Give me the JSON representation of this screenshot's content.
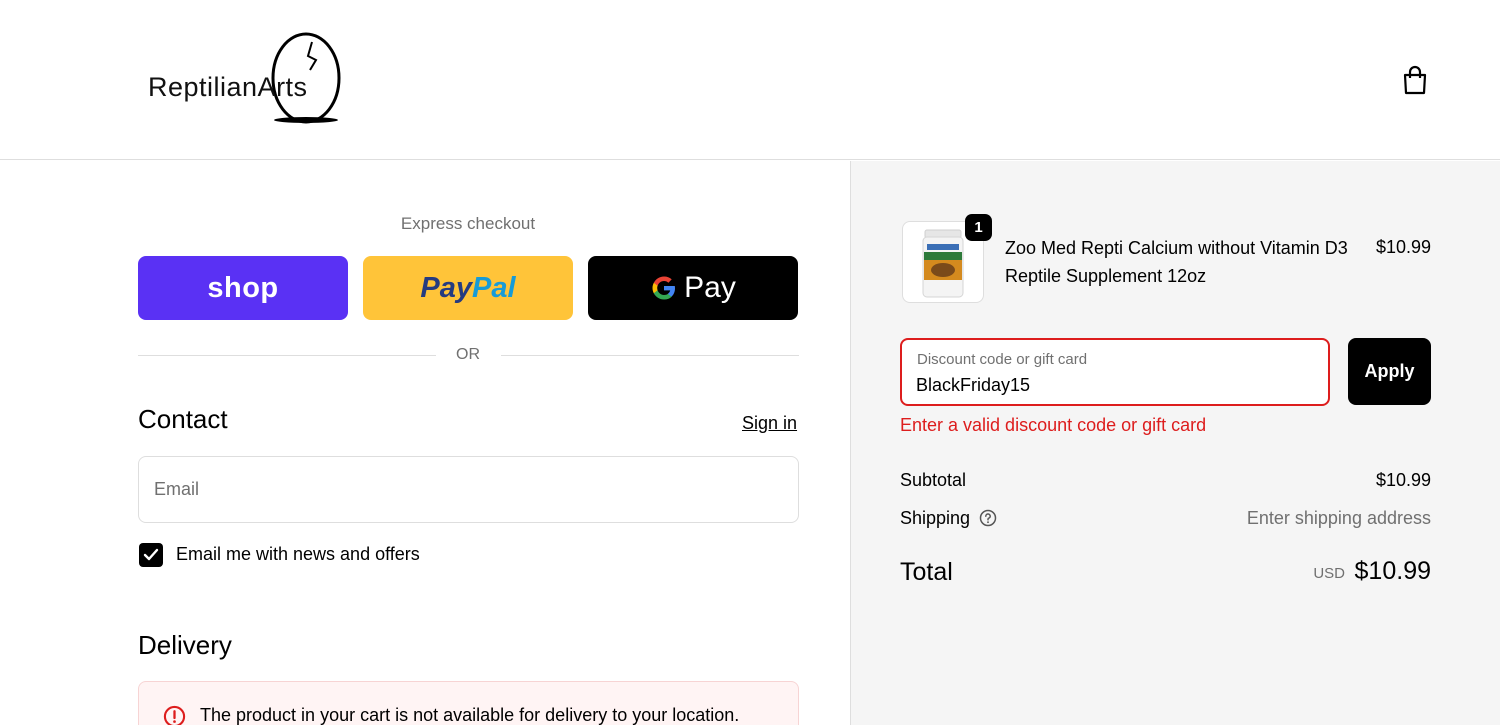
{
  "header": {
    "logo_text": "ReptilianArts"
  },
  "express": {
    "label": "Express checkout",
    "shop_label": "shop",
    "paypal_part1": "Pay",
    "paypal_part2": "Pal",
    "gpay_label": "Pay",
    "or_label": "OR"
  },
  "contact": {
    "heading": "Contact",
    "signin_label": "Sign in",
    "email_placeholder": "Email",
    "newsletter_label": "Email me with news and offers",
    "newsletter_checked": true
  },
  "delivery": {
    "heading": "Delivery",
    "alert_text": "The product in your cart is not available for delivery to your location."
  },
  "summary": {
    "product": {
      "name": "Zoo Med Repti Calcium without Vitamin D3 Reptile Supplement 12oz",
      "price": "$10.99",
      "quantity": "1"
    },
    "discount": {
      "label": "Discount code or gift card",
      "value": "BlackFriday15",
      "apply_label": "Apply",
      "error": "Enter a valid discount code or gift card"
    },
    "subtotal_label": "Subtotal",
    "subtotal_value": "$10.99",
    "shipping_label": "Shipping",
    "shipping_value": "Enter shipping address",
    "total_label": "Total",
    "total_currency": "USD",
    "total_value": "$10.99"
  },
  "colors": {
    "shop_purple": "#5a31f4",
    "paypal_yellow": "#ffc439",
    "error_red": "#dd1d1d",
    "sidebar_bg": "#f5f5f5"
  },
  "icons": {
    "logo": "egg-logo-icon",
    "cart": "shopping-bag-icon",
    "google": "google-g-icon",
    "check": "checkmark-icon",
    "alert": "alert-circle-icon",
    "help": "question-circle-icon"
  }
}
